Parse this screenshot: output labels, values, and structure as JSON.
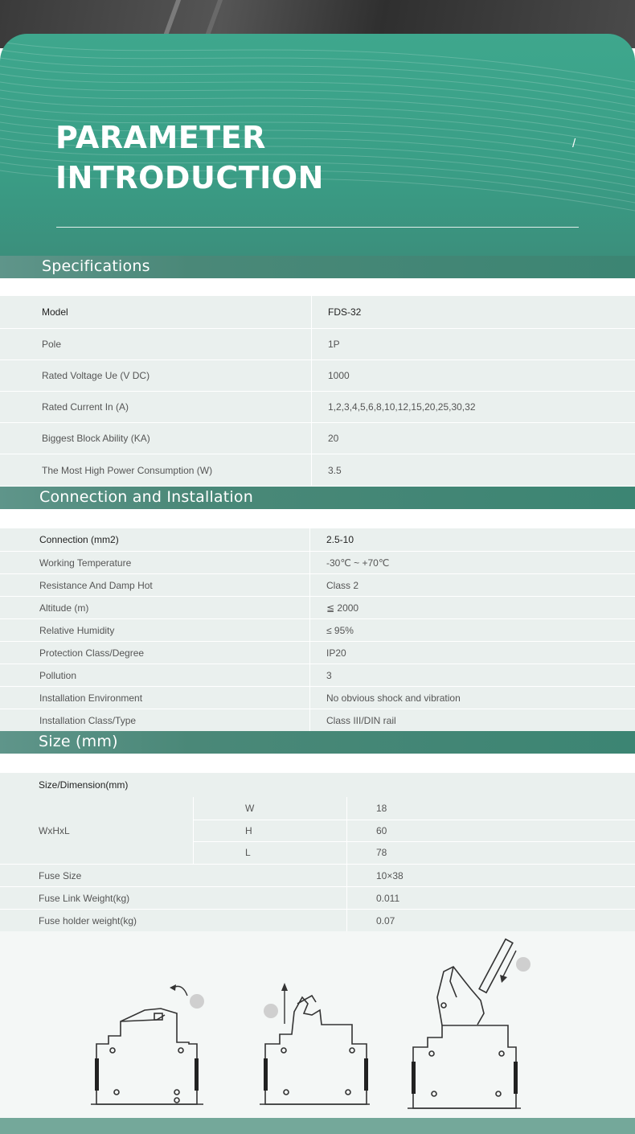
{
  "hero": {
    "title_line1": "PARAMETER",
    "title_line2": "INTRODUCTION",
    "slash": "/"
  },
  "specifications": {
    "heading": "Specifications",
    "rows": [
      {
        "label": "Model",
        "value": "FDS-32"
      },
      {
        "label": "Pole",
        "value": "1P"
      },
      {
        "label": "Rated Voltage Ue (V DC)",
        "value": "1000"
      },
      {
        "label": "Rated Current In (A)",
        "value": "1,2,3,4,5,6,8,10,12,15,20,25,30,32"
      },
      {
        "label": "Biggest Block Ability (KA)",
        "value": "20"
      },
      {
        "label": "The Most High Power Consumption (W)",
        "value": "3.5"
      }
    ]
  },
  "connection": {
    "heading": "Connection and Installation",
    "rows": [
      {
        "label": "Connection (mm2)",
        "value": "2.5-10"
      },
      {
        "label": "Working Temperature",
        "value": "-30℃ ~ +70℃"
      },
      {
        "label": "Resistance And Damp Hot",
        "value": "Class 2"
      },
      {
        "label": "Altitude (m)",
        "value": "≦ 2000"
      },
      {
        "label": "Relative Humidity",
        "value": "≤ 95%"
      },
      {
        "label": "Protection Class/Degree",
        "value": "IP20"
      },
      {
        "label": "Pollution",
        "value": "3"
      },
      {
        "label": "Installation Environment",
        "value": "No obvious shock and vibration"
      },
      {
        "label": "Installation Class/Type",
        "value": "Class III/DIN rail"
      }
    ]
  },
  "size": {
    "heading": "Size (mm)",
    "header_label": "Size/Dimension(mm)",
    "group_label": "WxHxL",
    "dims": [
      {
        "axis": "W",
        "value": "18"
      },
      {
        "axis": "H",
        "value": "60"
      },
      {
        "axis": "L",
        "value": "78"
      }
    ],
    "rows": [
      {
        "label": "Fuse Size",
        "value": "10×38"
      },
      {
        "label": "Fuse Link Weight(kg)",
        "value": "0.011"
      },
      {
        "label": "Fuse holder weight(kg)",
        "value": "0.07"
      }
    ]
  },
  "colors": {
    "hero_green": "#3ea78d",
    "header_green": "#4a8878",
    "table_bg": "#eaf0ee"
  },
  "icons": [
    "rotate-arrow-icon",
    "up-arrow-icon",
    "down-arrow-icon"
  ]
}
